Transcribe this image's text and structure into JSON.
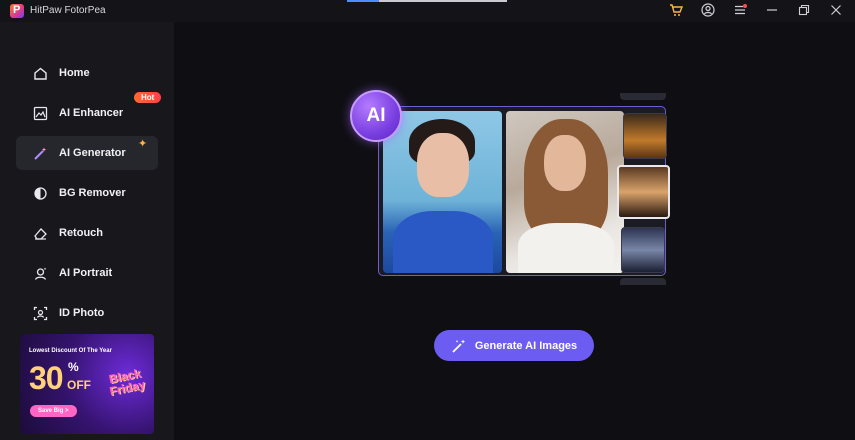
{
  "app": {
    "title": "HitPaw FotorPea"
  },
  "titlebar": {
    "icons": [
      "cart-icon",
      "user-icon",
      "menu-icon",
      "minimize-icon",
      "restore-icon",
      "close-icon"
    ]
  },
  "sidebar": {
    "items": [
      {
        "label": "Home",
        "icon": "home-icon"
      },
      {
        "label": "AI Enhancer",
        "icon": "enhancer-icon",
        "badge": "Hot"
      },
      {
        "label": "AI Generator",
        "icon": "magic-wand-icon",
        "active": true
      },
      {
        "label": "BG Remover",
        "icon": "bg-remover-icon"
      },
      {
        "label": "Retouch",
        "icon": "eraser-icon"
      },
      {
        "label": "AI Portrait",
        "icon": "portrait-icon"
      },
      {
        "label": "ID Photo",
        "icon": "id-photo-icon"
      }
    ],
    "promo": {
      "headline": "Lowest Discount Of The Year",
      "number": "30",
      "percent": "%",
      "off": "OFF",
      "event": "Black Friday",
      "button": "Save Big >"
    }
  },
  "main": {
    "badge": "AI",
    "generate_button": "Generate AI Images"
  },
  "colors": {
    "accent": "#6d5cf2",
    "hot_badge": "#ff4f3a",
    "sidebar_bg": "#17171c",
    "main_bg": "#0f0f13"
  }
}
